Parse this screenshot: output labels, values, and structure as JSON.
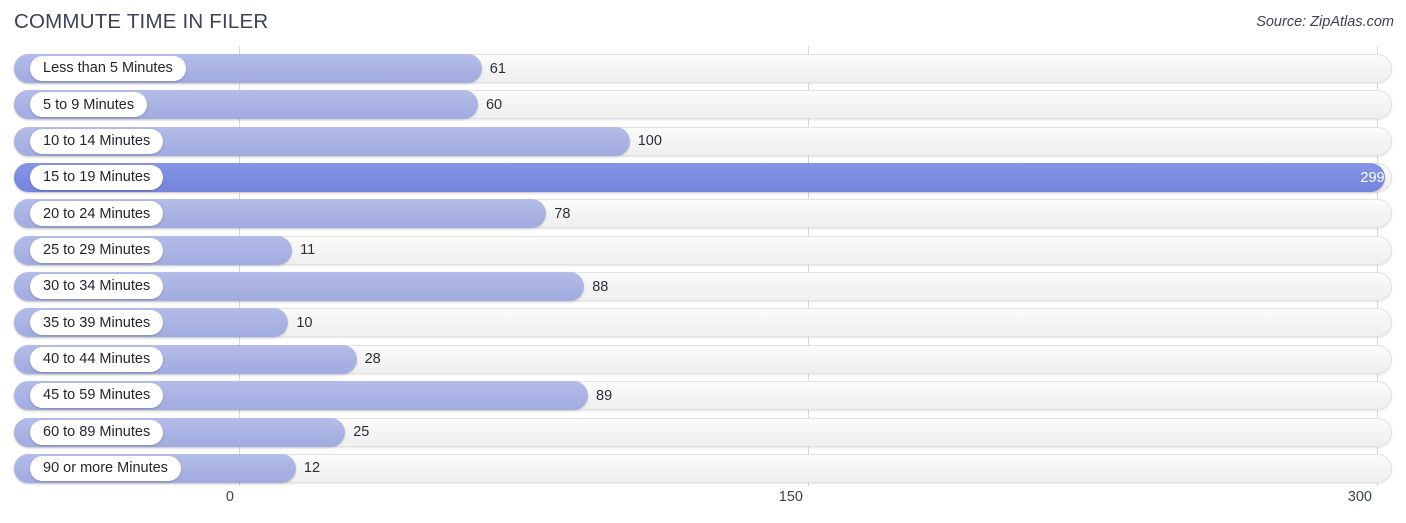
{
  "header": {
    "title": "COMMUTE TIME IN FILER",
    "source": "Source: ZipAtlas.com"
  },
  "colors": {
    "bar": "#a9b2e3",
    "bar_highlight": "#7b8bdf",
    "track": "#f4f4f4",
    "gridline": "#d8d8d8",
    "text": "#3c4257"
  },
  "chart_data": {
    "type": "bar",
    "orientation": "horizontal",
    "title": "COMMUTE TIME IN FILER",
    "xlabel": "",
    "ylabel": "",
    "xlim": [
      0,
      300
    ],
    "xticks": [
      "0",
      "150",
      "300"
    ],
    "xtick_values": [
      0,
      150,
      300
    ],
    "grid": true,
    "legend": false,
    "categories": [
      "Less than 5 Minutes",
      "5 to 9 Minutes",
      "10 to 14 Minutes",
      "15 to 19 Minutes",
      "20 to 24 Minutes",
      "25 to 29 Minutes",
      "30 to 34 Minutes",
      "35 to 39 Minutes",
      "40 to 44 Minutes",
      "45 to 59 Minutes",
      "60 to 89 Minutes",
      "90 or more Minutes"
    ],
    "values": [
      61,
      60,
      100,
      299,
      78,
      11,
      88,
      10,
      28,
      89,
      25,
      12
    ],
    "value_labels": [
      "61",
      "60",
      "100",
      "299",
      "78",
      "11",
      "88",
      "10",
      "28",
      "89",
      "25",
      "12"
    ],
    "highlight_index": 3
  }
}
